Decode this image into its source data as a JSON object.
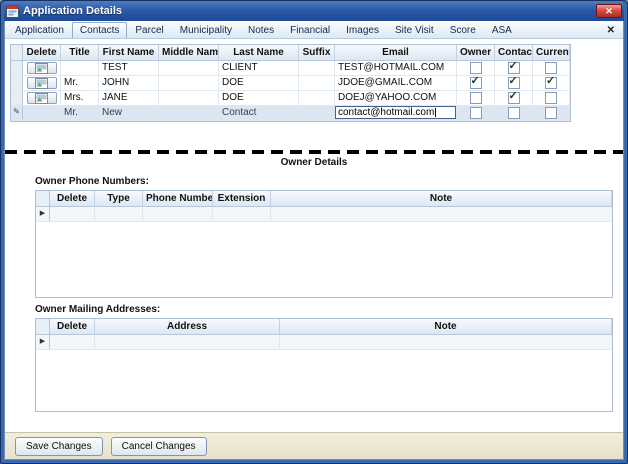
{
  "window": {
    "title": "Application Details",
    "close_glyph": "✕"
  },
  "tabs": {
    "items": [
      "Application",
      "Contacts",
      "Parcel",
      "Municipality",
      "Notes",
      "Financial",
      "Images",
      "Site Visit",
      "Score",
      "ASA"
    ],
    "selected_index": 1,
    "close_glyph": "✕"
  },
  "icons": {
    "edit_pencil": "✎",
    "new_row_arrow": "▶"
  },
  "contacts_grid": {
    "columns": [
      "Delete",
      "Title",
      "First Name",
      "Middle Name",
      "Last Name",
      "Suffix",
      "Email",
      "Owner",
      "Contact",
      "Current"
    ],
    "rows": [
      {
        "title": "",
        "first": "TEST",
        "middle": "",
        "last": "CLIENT",
        "suffix": "",
        "email": "TEST@HOTMAIL.COM",
        "owner": false,
        "contact": true,
        "current": false
      },
      {
        "title": "Mr.",
        "first": "JOHN",
        "middle": "",
        "last": "DOE",
        "suffix": "",
        "email": "JDOE@GMAIL.COM",
        "owner": true,
        "contact": true,
        "current": true
      },
      {
        "title": "Mrs.",
        "first": "JANE",
        "middle": "",
        "last": "DOE",
        "suffix": "",
        "email": "DOEJ@YAHOO.COM",
        "owner": false,
        "contact": true,
        "current": false
      }
    ],
    "edit_row": {
      "title": "Mr.",
      "first": "New",
      "middle": "",
      "last": "Contact",
      "suffix": "",
      "email": "contact@hotmail.com",
      "owner": false,
      "contact": false,
      "current": false
    }
  },
  "owner_details": {
    "header": "Owner Details",
    "phone_label": "Owner Phone Numbers:",
    "phone_columns": [
      "Delete",
      "Type",
      "Phone Number",
      "Extension",
      "Note"
    ],
    "address_label": "Owner Mailing Addresses:",
    "address_columns": [
      "Delete",
      "Address",
      "Note"
    ]
  },
  "footer": {
    "save_label": "Save Changes",
    "cancel_label": "Cancel Changes"
  },
  "colors": {
    "title_bar": "#2d5aa6",
    "close_button": "#b02a1f",
    "grid_header": "#dce7f3",
    "footer_bar": "#e6e2cc"
  }
}
